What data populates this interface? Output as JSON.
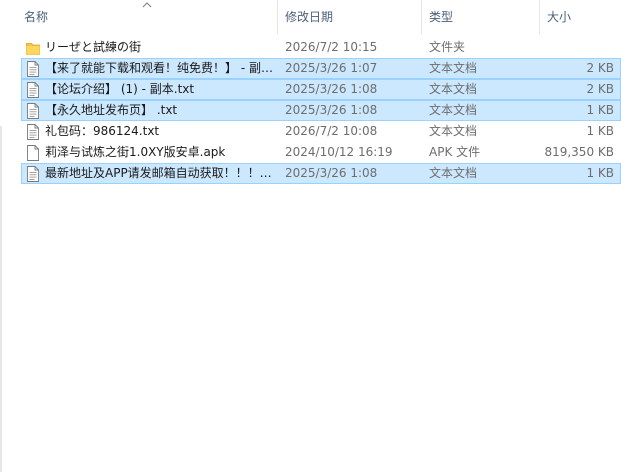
{
  "columns": {
    "name": "名称",
    "date": "修改日期",
    "type": "类型",
    "size": "大小"
  },
  "files": [
    {
      "name": "リーぜと試練の街",
      "date": "2026/7/2 10:15",
      "type": "文件夹",
      "size": "",
      "icon": "folder-icon",
      "selected": false
    },
    {
      "name": "【来了就能下载和观看！纯免费！】 - 副…",
      "date": "2025/3/26 1:07",
      "type": "文本文档",
      "size": "2 KB",
      "icon": "text-file-icon",
      "selected": true
    },
    {
      "name": "【论坛介绍】 (1) - 副本.txt",
      "date": "2025/3/26 1:08",
      "type": "文本文档",
      "size": "2 KB",
      "icon": "text-file-icon",
      "selected": true
    },
    {
      "name": "【永久地址发布页】 .txt",
      "date": "2025/3/26 1:08",
      "type": "文本文档",
      "size": "1 KB",
      "icon": "text-file-icon",
      "selected": true
    },
    {
      "name": "礼包码：986124.txt",
      "date": "2026/7/2 10:08",
      "type": "文本文档",
      "size": "1 KB",
      "icon": "text-file-icon",
      "selected": false
    },
    {
      "name": "莉泽与试炼之街1.0XY版安卓.apk",
      "date": "2024/10/12 16:19",
      "type": "APK 文件",
      "size": "819,350 KB",
      "icon": "file-icon",
      "selected": false
    },
    {
      "name": "最新地址及APP请发邮箱自动获取！！！…",
      "date": "2025/3/26 1:08",
      "type": "文本文档",
      "size": "1 KB",
      "icon": "text-file-icon",
      "selected": true
    }
  ],
  "colors": {
    "selected_bg": "#cce8ff",
    "selected_border": "#99d1ff",
    "folder": "#f5c342",
    "header_text": "#4c607a"
  }
}
